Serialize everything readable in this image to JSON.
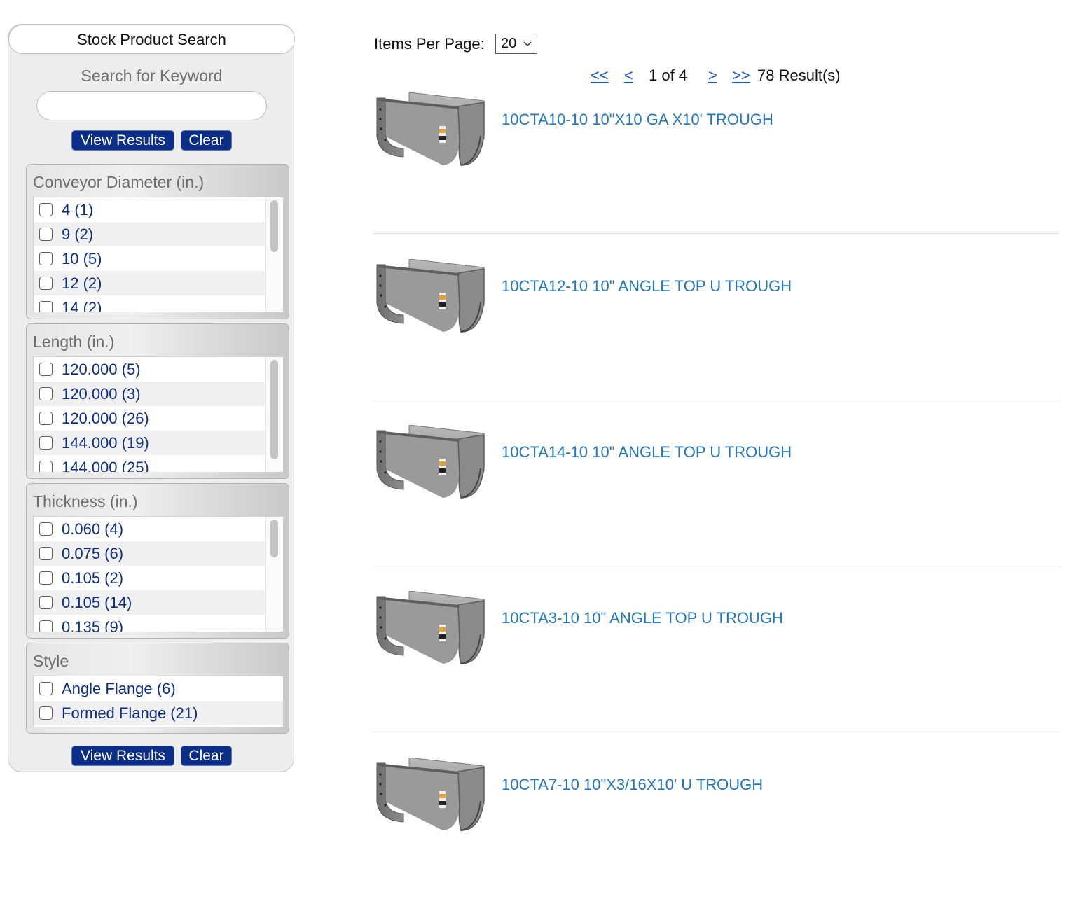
{
  "sidebar": {
    "title": "Stock Product Search",
    "keyword_label": "Search for Keyword",
    "keyword_value": "",
    "view_results_label": "View Results",
    "clear_label": "Clear",
    "facets": [
      {
        "title": "Conveyor Diameter (in.)",
        "items": [
          {
            "label": "4 (1)"
          },
          {
            "label": "9 (2)"
          },
          {
            "label": "10 (5)"
          },
          {
            "label": "12 (2)"
          },
          {
            "label": "14 (2)"
          }
        ]
      },
      {
        "title": "Length (in.)",
        "items": [
          {
            "label": "120.000 (5)"
          },
          {
            "label": "120.000 (3)"
          },
          {
            "label": "120.000 (26)"
          },
          {
            "label": "144.000 (19)"
          },
          {
            "label": "144.000 (25)"
          }
        ]
      },
      {
        "title": "Thickness (in.)",
        "items": [
          {
            "label": "0.060 (4)"
          },
          {
            "label": "0.075 (6)"
          },
          {
            "label": "0.105 (2)"
          },
          {
            "label": "0.105 (14)"
          },
          {
            "label": "0.135 (9)"
          }
        ]
      },
      {
        "title": "Style",
        "items": [
          {
            "label": "Angle Flange (6)"
          },
          {
            "label": "Formed Flange (21)"
          }
        ]
      }
    ]
  },
  "toolbar": {
    "items_per_page_label": "Items Per Page:",
    "items_per_page_value": "20"
  },
  "pager": {
    "first": "<<",
    "prev": "<",
    "info": "1 of 4",
    "next": ">",
    "last": ">>",
    "count": "78 Result(s)"
  },
  "results": [
    {
      "title": "10CTA10-10 10\"X10 GA X10' TROUGH",
      "image_icon": "u-trough-icon"
    },
    {
      "title": "10CTA12-10 10\" ANGLE TOP U TROUGH",
      "image_icon": "u-trough-icon"
    },
    {
      "title": "10CTA14-10 10\" ANGLE TOP U TROUGH",
      "image_icon": "u-trough-icon"
    },
    {
      "title": "10CTA3-10 10\" ANGLE TOP U TROUGH",
      "image_icon": "u-trough-icon"
    },
    {
      "title": "10CTA7-10 10\"X3/16X10' U TROUGH",
      "image_icon": "u-trough-icon"
    }
  ],
  "colors": {
    "button_bg": "#0b2f88",
    "facet_link": "#0c2f82",
    "result_link": "#2277bb",
    "pager_link": "#1a56c9"
  }
}
